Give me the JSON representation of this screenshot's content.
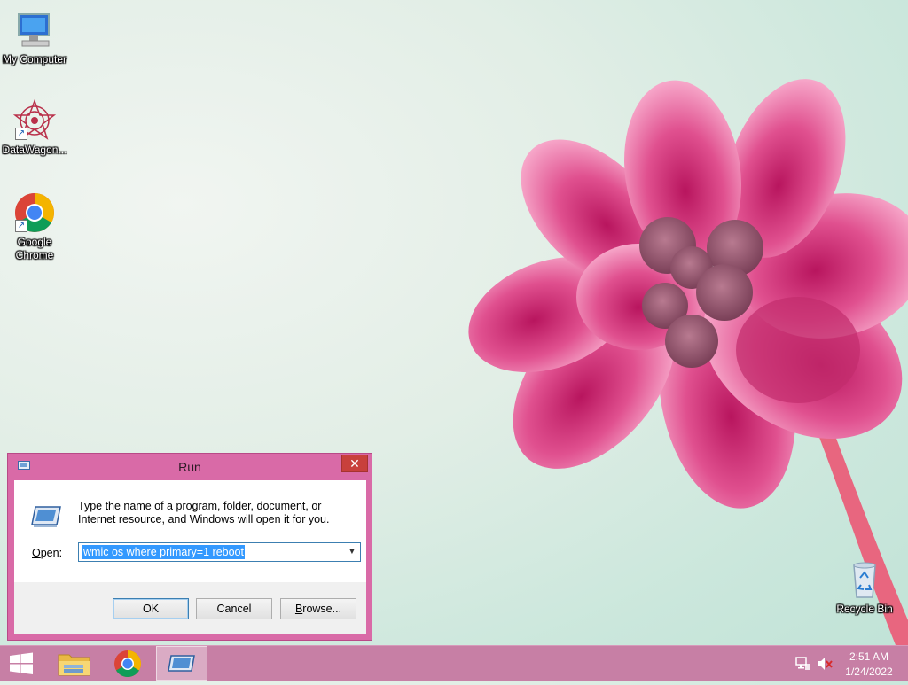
{
  "desktop": {
    "icons": [
      {
        "label": "My Computer"
      },
      {
        "label": "DataWagon..."
      },
      {
        "label": "Google Chrome"
      },
      {
        "label": "Recycle Bin"
      }
    ]
  },
  "run_dialog": {
    "title": "Run",
    "close_glyph": "✕",
    "description": "Type the name of a program, folder, document, or Internet resource, and Windows will open it for you.",
    "open_label_access": "O",
    "open_label_rest": "pen:",
    "open_value": "wmic os where primary=1 reboot",
    "ok_label": "OK",
    "cancel_label": "Cancel",
    "browse_access": "B",
    "browse_rest": "rowse..."
  },
  "taskbar": {
    "items": [
      "start-icon",
      "file-explorer-icon",
      "chrome-icon",
      "run-icon"
    ],
    "tray": {
      "icons": [
        "network-icon",
        "volume-muted-icon"
      ]
    },
    "clock_time": "2:51 AM",
    "clock_date": "1/24/2022"
  },
  "colors": {
    "dialog_frame": "#d96aa7",
    "taskbar": "#c77fa5",
    "close_button": "#c8403c",
    "selection": "#3399ff"
  }
}
